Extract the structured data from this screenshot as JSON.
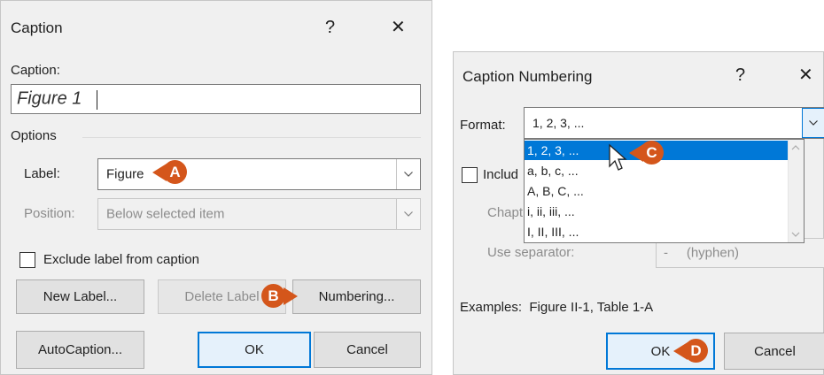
{
  "caption_dialog": {
    "title": "Caption",
    "help_label": "?",
    "close_label": "✕",
    "caption_label": "Caption:",
    "caption_value": "Figure 1",
    "options_label": "Options",
    "label_label": "Label:",
    "label_value": "Figure",
    "position_label": "Position:",
    "position_value": "Below selected item",
    "exclude_label": "Exclude label from caption",
    "new_label_button": "New Label...",
    "delete_label_button": "Delete Label",
    "numbering_button": "Numbering...",
    "autocaption_button": "AutoCaption...",
    "ok_button": "OK",
    "cancel_button": "Cancel"
  },
  "numbering_dialog": {
    "title": "Caption Numbering",
    "help_label": "?",
    "close_label": "✕",
    "format_label": "Format:",
    "format_value": "1, 2, 3, ...",
    "format_options": [
      "1, 2, 3, ...",
      "a, b, c, ...",
      "A, B, C, ...",
      "i, ii, iii, ...",
      "I, II, III, ..."
    ],
    "include_label_partial": "Includ",
    "chapter_label_partial": "Chapt",
    "use_separator_label": "Use separator:",
    "separator_value": "-     (hyphen)",
    "examples_label": "Examples:",
    "examples_value": "Figure II-1, Table 1-A",
    "ok_button": "OK",
    "cancel_button": "Cancel"
  },
  "callouts": {
    "a": "A",
    "b": "B",
    "c": "C",
    "d": "D"
  },
  "colors": {
    "callout": "#d4561b",
    "selection": "#0078d7",
    "dialog_bg": "#f0f0f0"
  }
}
